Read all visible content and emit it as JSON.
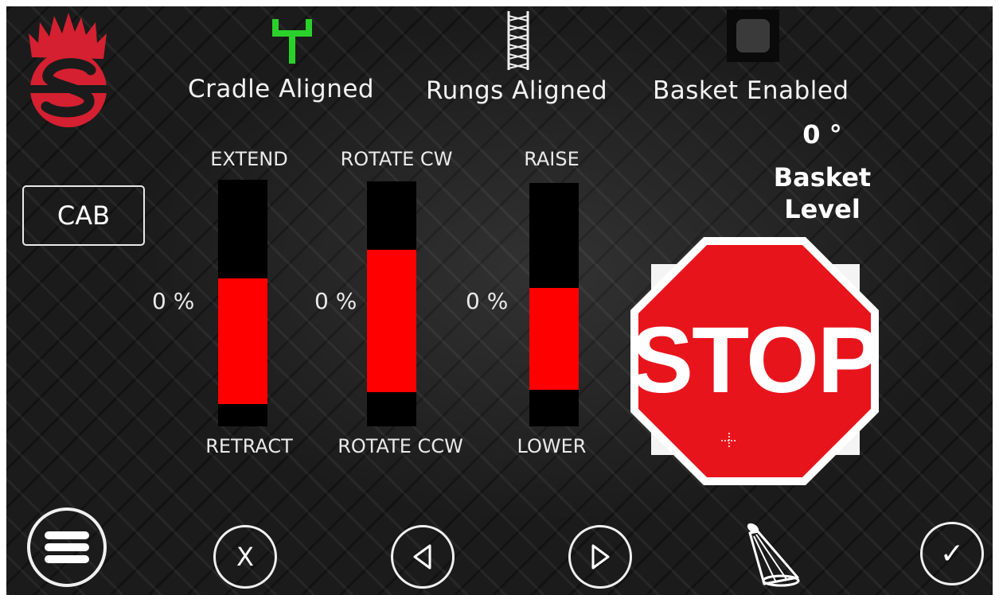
{
  "status": {
    "cradle": {
      "label": "Cradle Aligned",
      "icon": "cradle-icon",
      "color": "#2bd12b"
    },
    "rungs": {
      "label": "Rungs Aligned",
      "icon": "ladder-rungs-icon"
    },
    "basket": {
      "label": "Basket Enabled",
      "icon": "basket-indicator-icon"
    }
  },
  "basket_level": {
    "value": "0 °",
    "label_line1": "Basket",
    "label_line2": "Level"
  },
  "cab_button": {
    "label": "CAB"
  },
  "gauges": [
    {
      "top_label": "EXTEND",
      "bottom_label": "RETRACT",
      "percent": "0 %",
      "fill_start": 0.4,
      "fill_end": 0.91
    },
    {
      "top_label": "ROTATE CW",
      "bottom_label": "ROTATE CCW",
      "percent": "0 %",
      "fill_start": 0.28,
      "fill_end": 0.86
    },
    {
      "top_label": "RAISE",
      "bottom_label": "LOWER",
      "percent": "0 %",
      "fill_start": 0.43,
      "fill_end": 0.85
    }
  ],
  "stop_sign": {
    "text": "STOP",
    "color": "#e8141c"
  },
  "bottom_bar": {
    "menu": {
      "icon": "hamburger-menu-icon"
    },
    "cancel": {
      "label": "X"
    },
    "prev": {
      "icon": "left-triangle-icon"
    },
    "next": {
      "icon": "right-triangle-icon"
    },
    "light": {
      "icon": "spotlight-icon"
    },
    "confirm": {
      "label": "✓"
    }
  },
  "colors": {
    "accent_red": "#ff0000",
    "logo_red": "#d42030",
    "cradle_green": "#2bd12b"
  }
}
